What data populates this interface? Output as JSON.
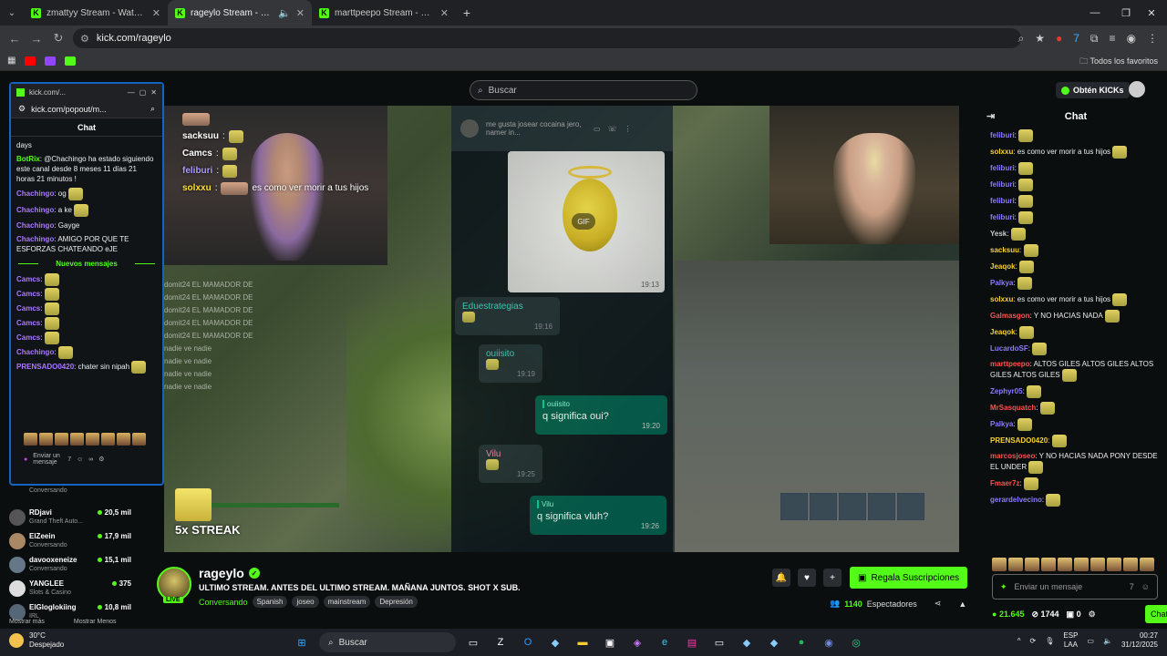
{
  "browser": {
    "tabs": [
      {
        "title": "zmattyy Stream - Watch Live on",
        "active": false
      },
      {
        "title": "rageylo Stream - Watch Live",
        "active": true
      },
      {
        "title": "marttpeepo Stream - Watch Live",
        "active": false
      }
    ],
    "url": "kick.com/rageylo",
    "bookmarks_all": "Todos los favoritos"
  },
  "header": {
    "search_placeholder": "Buscar",
    "get_kicks": "Obtén KICKs"
  },
  "popout": {
    "title": "kick.com/...",
    "url": "kick.com/popout/m...",
    "chat_title": "Chat",
    "messages": [
      {
        "user": "",
        "text": "days"
      },
      {
        "user": "BotRix",
        "text": ": @Chachingo ha estado siguiendo este canal desde 8 meses 11 días 21 horas 21 minutos !"
      },
      {
        "user": "Chachingo",
        "text": ": og"
      },
      {
        "user": "Chachingo",
        "text": ": a ke"
      },
      {
        "user": "Chachingo",
        "text": ": Gayge"
      },
      {
        "user": "Chachingo",
        "text": ": AMIGO POR QUE TE ESFORZAS CHATEANDO eJE"
      }
    ],
    "new_messages": "Nuevos mensajes",
    "new_list": [
      {
        "user": "Camcs",
        "text": ":"
      },
      {
        "user": "Camcs",
        "text": ":"
      },
      {
        "user": "Camcs",
        "text": ":"
      },
      {
        "user": "Camcs",
        "text": ":"
      },
      {
        "user": "Camcs",
        "text": ":"
      },
      {
        "user": "Chachingo",
        "text": ":"
      },
      {
        "user": "PRENSADO0420",
        "text": ": chater sin nipah"
      }
    ],
    "input_placeholder": "Enviar un mensaje"
  },
  "video": {
    "overlay_chat": [
      {
        "user": "sacksuu",
        "text": ":"
      },
      {
        "user": "Camcs",
        "text": ":"
      },
      {
        "user": "feliburi",
        "text": ":"
      },
      {
        "user": "solxxu",
        "text": ":"
      }
    ],
    "overlay_quote": "es como ver morir a tus hijos",
    "spam_lines": [
      "domit24 EL MAMADOR DE",
      "domit24 EL MAMADOR DE",
      "domit24 EL MAMADOR DE",
      "domit24 EL MAMADOR DE",
      "domit24 EL MAMADOR DE",
      "nadie ve   nadie",
      "nadie ve   nadie",
      "nadie ve   nadie",
      "nadie ve   nadie"
    ],
    "wa_header": "me gusta josear cocaina jero, namer in...",
    "wa_messages": [
      {
        "sender": "Eduestrategias",
        "time": "19:16"
      },
      {
        "sender": "ouiisito",
        "time": "19:19"
      },
      {
        "sender": "Vilu",
        "time": "19:25"
      }
    ],
    "wa_out": [
      {
        "quote": "ouiisito",
        "text": "q significa oui?",
        "time": "19:20"
      },
      {
        "quote": "Vilu",
        "text": "q significa vluh?",
        "time": "19:26"
      }
    ],
    "gif_label": "GIF",
    "gif_time": "19:13",
    "streak": "5x STREAK"
  },
  "stream": {
    "channel": "rageylo",
    "live": "LIVE",
    "title": "ULTIMO STREAM. ANTES DEL ULTIMO STREAM. MAÑANA JUNTOS. SHOT X SUB.",
    "category": "Conversando",
    "tags": [
      "Spanish",
      "joseo",
      "mainstream",
      "Depresión"
    ],
    "subscribe": "Regala Suscripciones",
    "viewers": "1140",
    "viewers_label": "Espectadores"
  },
  "recommended": [
    {
      "name": "",
      "game": "Conversando",
      "viewers": ""
    },
    {
      "name": "RDjavi",
      "game": "Grand Theft Auto...",
      "viewers": "20,5 mil"
    },
    {
      "name": "ElZeein",
      "game": "Conversando",
      "viewers": "17,9 mil"
    },
    {
      "name": "davooxeneize",
      "game": "Conversando",
      "viewers": "15,1 mil"
    },
    {
      "name": "YANGLEE",
      "game": "Slots & Casino",
      "viewers": "375"
    },
    {
      "name": "ElGloglokiing",
      "game": "IRL",
      "viewers": "10,8 mil"
    }
  ],
  "rec_footer": {
    "more": "Mostrar más",
    "less": "Mostrar Menos"
  },
  "chat": {
    "title": "Chat",
    "messages": [
      {
        "user": "feliburi",
        "color": "#8a7cff",
        "text": ":"
      },
      {
        "user": "solxxu",
        "color": "#f5d130",
        "text": ":  es como ver morir a tus hijos"
      },
      {
        "user": "feliburi",
        "color": "#8a7cff",
        "text": ":"
      },
      {
        "user": "feliburi",
        "color": "#8a7cff",
        "text": ":"
      },
      {
        "user": "feliburi",
        "color": "#8a7cff",
        "text": ":"
      },
      {
        "user": "feliburi",
        "color": "#8a7cff",
        "text": ":"
      },
      {
        "user": "Yesk",
        "color": "#ccc",
        "text": ":"
      },
      {
        "user": "sacksuu",
        "color": "#f5d130",
        "text": ":"
      },
      {
        "user": "Jeaqok",
        "color": "#f5d130",
        "text": ":"
      },
      {
        "user": "Palkya",
        "color": "#8a7cff",
        "text": ":"
      },
      {
        "user": "solxxu",
        "color": "#f5d130",
        "text": ":  es como ver morir a tus hijos"
      },
      {
        "user": "Galmasgon",
        "color": "#ff5050",
        "text": ": Y NO HACIAS NADA"
      },
      {
        "user": "Jeaqok",
        "color": "#f5d130",
        "text": ":"
      },
      {
        "user": "LucardoSF",
        "color": "#8a7cff",
        "text": ":"
      },
      {
        "user": "marttpeepo",
        "color": "#ff5050",
        "text": ": ALTOS GILES ALTOS GILES ALTOS GILES ALTOS GILES"
      },
      {
        "user": "Zephyr05",
        "color": "#8a7cff",
        "text": ":"
      },
      {
        "user": "MrSasquatch",
        "color": "#ff5050",
        "text": ":"
      },
      {
        "user": "Palkya",
        "color": "#8a7cff",
        "text": ":"
      },
      {
        "user": "PRENSADO0420",
        "color": "#f5d130",
        "text": ":"
      },
      {
        "user": "marcosjoseo",
        "color": "#ff5050",
        "text": ": Y NO HACIAS NADA PONY DESDE EL UNDER"
      },
      {
        "user": "Fmaer7z",
        "color": "#ff5050",
        "text": ":"
      },
      {
        "user": "gerardelvecino",
        "color": "#8a7cff",
        "text": ":"
      }
    ],
    "input_placeholder": "Enviar un mensaje",
    "kicks_balance": "21.645",
    "points": "1744",
    "gifts": "0",
    "chat_button": "Chat"
  },
  "taskbar": {
    "temp": "30°C",
    "weather": "Despejado",
    "search": "Buscar",
    "lang1": "ESP",
    "lang2": "LAA",
    "time": "00:27",
    "date": "31/12/2025"
  }
}
